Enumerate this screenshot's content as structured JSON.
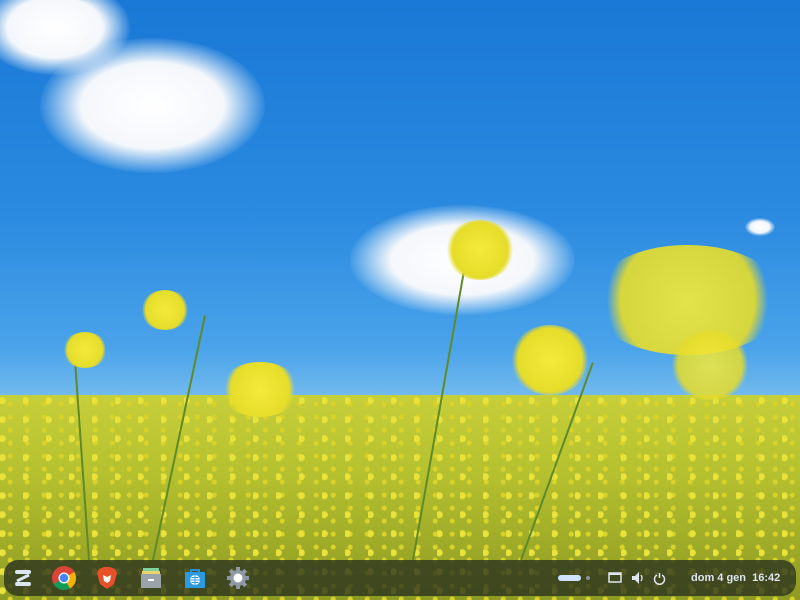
{
  "taskbar": {
    "apps": [
      {
        "name": "Zorin menu",
        "icon": "zorin-logo-icon"
      },
      {
        "name": "Google Chrome",
        "icon": "chrome-icon"
      },
      {
        "name": "Brave",
        "icon": "brave-icon"
      },
      {
        "name": "Files",
        "icon": "files-icon"
      },
      {
        "name": "Software",
        "icon": "software-store-icon"
      },
      {
        "name": "Settings",
        "icon": "settings-icon"
      }
    ],
    "tray": {
      "clock": "dom 4 gen  16:42"
    }
  }
}
